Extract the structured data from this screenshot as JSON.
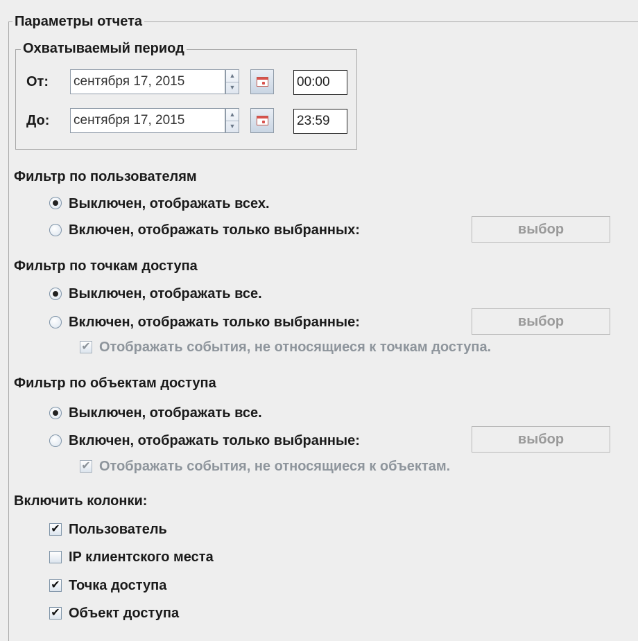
{
  "report_params": {
    "title": "Параметры отчета",
    "period": {
      "title": "Охватываемый период",
      "from_label": "От:",
      "from_date": "сентября 17, 2015",
      "from_time": "00:00",
      "to_label": "До:",
      "to_date": "сентября 17, 2015",
      "to_time": "23:59"
    }
  },
  "user_filter": {
    "heading": "Фильтр по пользователям",
    "option_off": "Выключен, отображать всех.",
    "option_on": "Включен, отображать только выбранных:",
    "select_button": "выбор",
    "selected": "off"
  },
  "access_point_filter": {
    "heading": "Фильтр по точкам доступа",
    "option_off": "Выключен, отображать все.",
    "option_on": "Включен, отображать только выбранные:",
    "select_button": "выбор",
    "extra_checkbox": "Отображать события, не относящиеся к точкам доступа.",
    "extra_checked": true,
    "selected": "off"
  },
  "access_object_filter": {
    "heading": "Фильтр по объектам доступа",
    "option_off": "Выключен, отображать все.",
    "option_on": "Включен, отображать только выбранные:",
    "select_button": "выбор",
    "extra_checkbox": "Отображать события, не относящиеся к объектам.",
    "extra_checked": true,
    "selected": "off"
  },
  "columns": {
    "heading": "Включить колонки:",
    "items": [
      {
        "label": "Пользователь",
        "checked": true
      },
      {
        "label": "IP клиентского места",
        "checked": false
      },
      {
        "label": "Точка доступа",
        "checked": true
      },
      {
        "label": "Объект доступа",
        "checked": true
      }
    ]
  },
  "icons": {
    "spinner_up": "spinner-up-arrow-icon",
    "spinner_down": "spinner-down-arrow-icon",
    "calendar": "calendar-icon",
    "check": "✔"
  }
}
